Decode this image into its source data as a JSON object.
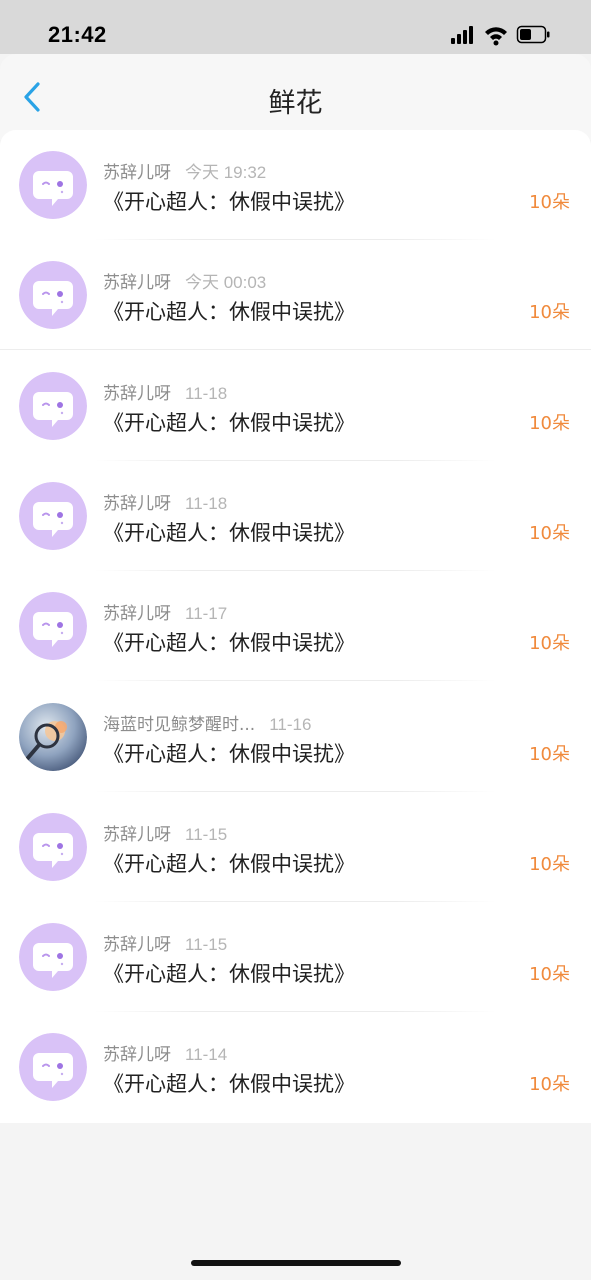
{
  "status_bar": {
    "time": "21:42"
  },
  "nav": {
    "title": "鲜花"
  },
  "items": [
    {
      "sender": "苏辞儿呀",
      "time": "今天 19:32",
      "title": "《开心超人：休假中误扰》",
      "count": "10朵",
      "avatar": "chat-bubble-icon"
    },
    {
      "sender": "苏辞儿呀",
      "time": "今天 00:03",
      "title": "《开心超人：休假中误扰》",
      "count": "10朵",
      "avatar": "chat-bubble-icon"
    },
    {
      "sender": "苏辞儿呀",
      "time": "11-18",
      "title": "《开心超人：休假中误扰》",
      "count": "10朵",
      "avatar": "chat-bubble-icon"
    },
    {
      "sender": "苏辞儿呀",
      "time": "11-18",
      "title": "《开心超人：休假中误扰》",
      "count": "10朵",
      "avatar": "chat-bubble-icon"
    },
    {
      "sender": "苏辞儿呀",
      "time": "11-17",
      "title": "《开心超人：休假中误扰》",
      "count": "10朵",
      "avatar": "chat-bubble-icon"
    },
    {
      "sender": "海蓝时见鲸梦醒时...",
      "time": "11-16",
      "title": "《开心超人：休假中误扰》",
      "count": "10朵",
      "avatar": "photo-avatar"
    },
    {
      "sender": "苏辞儿呀",
      "time": "11-15",
      "title": "《开心超人：休假中误扰》",
      "count": "10朵",
      "avatar": "chat-bubble-icon"
    },
    {
      "sender": "苏辞儿呀",
      "time": "11-15",
      "title": "《开心超人：休假中误扰》",
      "count": "10朵",
      "avatar": "chat-bubble-icon"
    },
    {
      "sender": "苏辞儿呀",
      "time": "11-14",
      "title": "《开心超人：休假中误扰》",
      "count": "10朵",
      "avatar": "chat-bubble-icon"
    }
  ],
  "colors": {
    "accent": "#2aa3e6",
    "count": "#f08a3c",
    "avatar_bg": "#d9c2f7"
  }
}
